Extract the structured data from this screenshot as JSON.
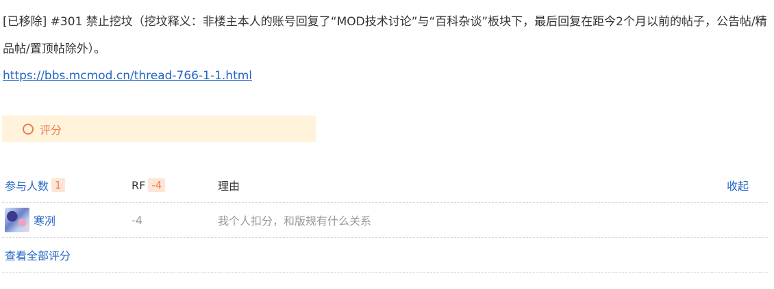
{
  "post": {
    "text": "[已移除] #301 禁止挖坟（挖坟释义：非楼主本人的账号回复了“MOD技术讨论”与“百科杂谈”板块下，最后回复在距今2个月以前的帖子，公告帖/精品帖/置顶帖除外）。",
    "link": "https://bbs.mcmod.cn/thread-766-1-1.html"
  },
  "rate": {
    "header_label": "评分",
    "columns": {
      "participants_label": "参与人数",
      "participants_count": "1",
      "rf_label": "RF",
      "rf_total": "-4",
      "reason_label": "理由",
      "collapse_label": "收起"
    },
    "entries": [
      {
        "user": "寒冽",
        "score": "-4",
        "reason": "我个人扣分，和版规有什么关系"
      }
    ],
    "view_all_label": "查看全部评分"
  },
  "colors": {
    "accent_orange": "#ef7b4b",
    "link_blue": "#2366c7",
    "rate_bar_bg": "#fff3dc"
  }
}
